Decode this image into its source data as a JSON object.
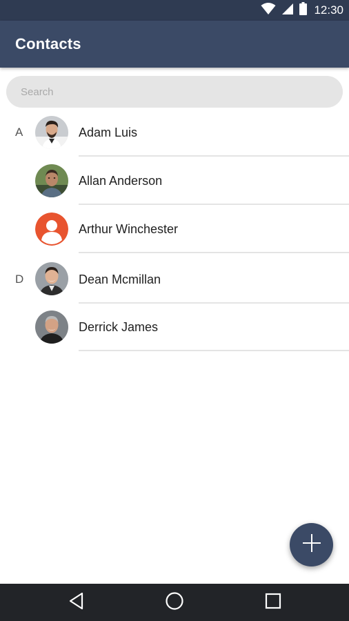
{
  "status_bar": {
    "time": "12:30",
    "icons": [
      "wifi-icon",
      "cell-signal-icon",
      "battery-icon"
    ]
  },
  "app_bar": {
    "title": "Contacts"
  },
  "search": {
    "placeholder": "Search",
    "value": ""
  },
  "contacts": [
    {
      "section": "A",
      "name": "Adam Luis",
      "avatar": "photo"
    },
    {
      "section": "",
      "name": "Allan Anderson",
      "avatar": "photo"
    },
    {
      "section": "",
      "name": "Arthur Winchester",
      "avatar": "default-person-icon"
    },
    {
      "section": "D",
      "name": "Dean Mcmillan",
      "avatar": "photo"
    },
    {
      "section": "",
      "name": "Derrick James",
      "avatar": "photo"
    }
  ],
  "fab": {
    "icon": "plus-icon"
  },
  "nav_bar": {
    "icons": [
      "back-icon",
      "home-icon",
      "recents-icon"
    ]
  },
  "colors": {
    "status_bar": "#2f3b52",
    "app_bar": "#3b4a66",
    "fab": "#3b4a66",
    "default_avatar": "#e8542f",
    "nav_bar": "#222428",
    "search_bg": "#e5e5e5"
  }
}
